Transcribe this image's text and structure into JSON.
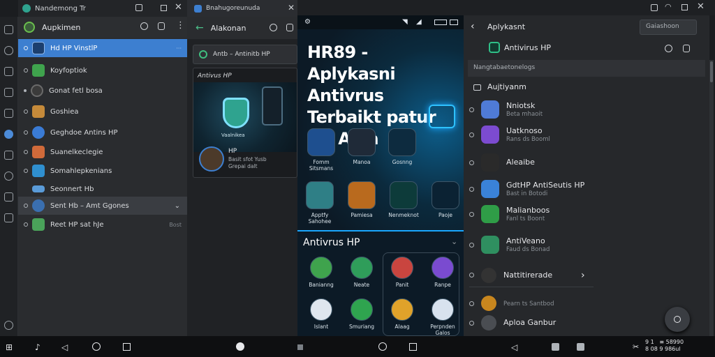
{
  "panel1": {
    "tab_title": "Nandemong Tr",
    "header_title": "Aupkimen",
    "items": [
      {
        "label": "Hd HP VinstlP",
        "meta": "",
        "color": "#4c8bd8",
        "selected": true
      },
      {
        "label": "Koyfoptiok",
        "meta": "",
        "color": "#3fa34d"
      },
      {
        "label": "Gonat fetl bosa",
        "meta": "",
        "color": "#3b3b3b"
      },
      {
        "label": "Goshiea",
        "meta": "",
        "color": "#c58a3a"
      },
      {
        "label": "Geghdoe Antins HP",
        "meta": "",
        "color": "#3a7bd5"
      },
      {
        "label": "Suanelkeclegie",
        "meta": "",
        "color": "#d06a3a"
      },
      {
        "label": "Somahlepkenians",
        "meta": "",
        "color": "#2f8fcf"
      },
      {
        "label": "Seonnert Hb",
        "meta": "",
        "color": "#5a9bd8"
      },
      {
        "label": "Sent Hb – Amt Ggones",
        "meta": "",
        "color": "#3a6fb0",
        "hovered": true
      },
      {
        "label": "Reet HP sat hJe",
        "meta": "Bost",
        "color": "#4aa35a"
      }
    ]
  },
  "panel2": {
    "tab_title": "Bnahugoreunuda",
    "header_title": "Alakonan",
    "search_text": "Antb – Antinitb HP",
    "card_title": "Antivus HP",
    "shield_label": "Vaalnikea",
    "user_name": "HP",
    "user_desc": "Basit sfot Yusb\nGrepai dalt"
  },
  "poster": {
    "title": "HR89 - Aplykasni Antivrus Terbaikt patur HP Anja",
    "apps_top": [
      {
        "label": "Fomm Sitsmans",
        "color": "#1e4f8f"
      },
      {
        "label": "Manoa",
        "color": "#1f2a38"
      },
      {
        "label": "Gosnng",
        "color": "#0d2b3f"
      }
    ],
    "apps_mid": [
      {
        "label": "Apptfy Sahohee",
        "color": "#2f7f86"
      },
      {
        "label": "Pamiesa",
        "color": "#b96a1e"
      },
      {
        "label": "Nenmeknot",
        "color": "#0d3b3a"
      },
      {
        "label": "Paoje",
        "color": "#0b2233"
      }
    ],
    "section_title": "Antivrus HP",
    "apps_row1": [
      {
        "label": "Banianng",
        "color": "#3fa34d"
      },
      {
        "label": "Neate",
        "color": "#2f9d5a"
      },
      {
        "label": "Panit",
        "color": "#c9453f"
      },
      {
        "label": "Ranpe",
        "color": "#7a4bd0"
      }
    ],
    "apps_row2": [
      {
        "label": "Islant",
        "color": "#dfe6ee"
      },
      {
        "label": "Smuriang",
        "color": "#2fa44f"
      },
      {
        "label": "Alaag",
        "color": "#e0a22a"
      },
      {
        "label": "Perpnden Galos",
        "color": "#d8e2ee"
      }
    ]
  },
  "panel4": {
    "header_title": "Aplykasnt",
    "search_placeholder": "Gaiashoon",
    "app_title": "Antivirus HP",
    "section_label": "Nangtabaetonelogs",
    "group_title": "Aujtiyanm",
    "items": [
      {
        "t1": "Nniotsk",
        "t2": "Beta mhaoit",
        "color": "#4f7bd6"
      },
      {
        "t1": "Uatknoso",
        "t2": "Rans ds Booml",
        "color": "#7c4bd0"
      },
      {
        "t1": "Aleaibe",
        "t2": "",
        "color": "#2a2a2a"
      },
      {
        "t1": "GdtHP AntiSeutis HP",
        "t2": "Bast in Botodi",
        "color": "#3a82d8"
      },
      {
        "t1": "Malianboos",
        "t2": "Fanl ts Boont",
        "color": "#2f9d47"
      },
      {
        "t1": "AntiVeano",
        "t2": "Faud ds Bonad",
        "color": "#2f8f60"
      },
      {
        "t1": "Nattitirerade",
        "t2": "",
        "color": "#333"
      },
      {
        "t1": "",
        "t2": "Pearn ts Santbod",
        "color": "#c8861e"
      },
      {
        "t1": "Aploa Ganbur",
        "t2": "",
        "color": "#4a4d52"
      }
    ]
  },
  "taskbar": {
    "clock": "9 1   ≡ 58990\n8 08 9 986ul"
  }
}
